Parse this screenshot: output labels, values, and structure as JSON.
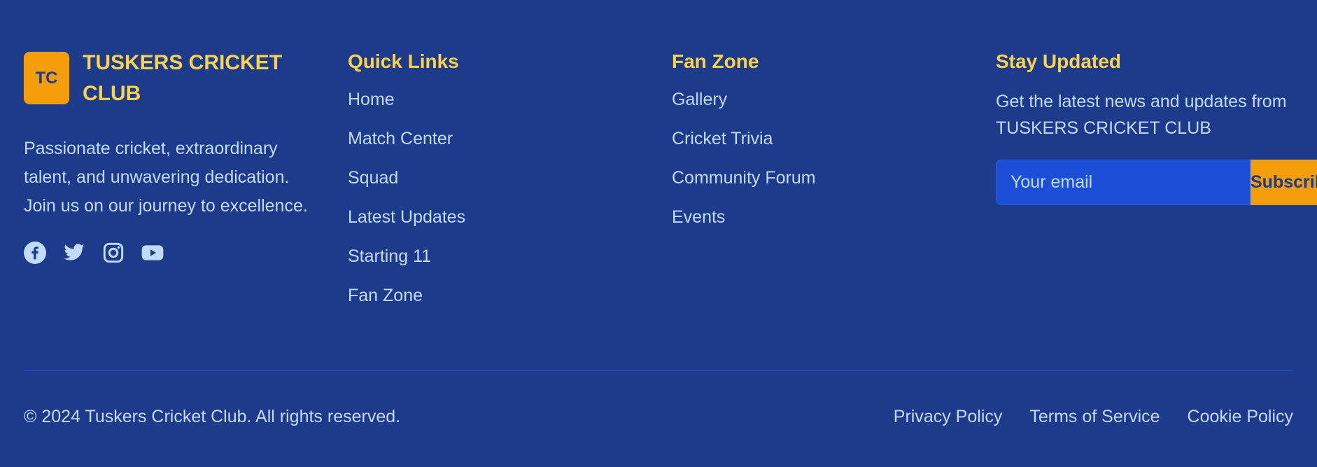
{
  "brand": {
    "logo_initials": "TC",
    "name": "TUSKERS CRICKET CLUB",
    "tagline": "Passionate cricket, extraordinary talent, and unwavering dedication. Join us on our journey to excellence."
  },
  "socials": [
    {
      "icon": "facebook-icon"
    },
    {
      "icon": "twitter-icon"
    },
    {
      "icon": "instagram-icon"
    },
    {
      "icon": "youtube-icon"
    }
  ],
  "quick_links": {
    "title": "Quick Links",
    "items": [
      "Home",
      "Match Center",
      "Squad",
      "Latest Updates",
      "Starting 11",
      "Fan Zone"
    ]
  },
  "fan_zone": {
    "title": "Fan Zone",
    "items": [
      "Gallery",
      "Cricket Trivia",
      "Community Forum",
      "Events"
    ]
  },
  "newsletter": {
    "title": "Stay Updated",
    "text": "Get the latest news and updates from TUSKERS CRICKET CLUB",
    "placeholder": "Your email",
    "button_label": "Subscribe"
  },
  "footer_bottom": {
    "copyright": "© 2024 Tuskers Cricket Club. All rights reserved.",
    "links": [
      "Privacy Policy",
      "Terms of Service",
      "Cookie Policy"
    ]
  },
  "colors": {
    "background": "#1e3a8a",
    "accent": "#f59e0b",
    "heading": "#fcd34d",
    "text": "#bfdbfe",
    "input_bg": "#1d4ed8"
  }
}
